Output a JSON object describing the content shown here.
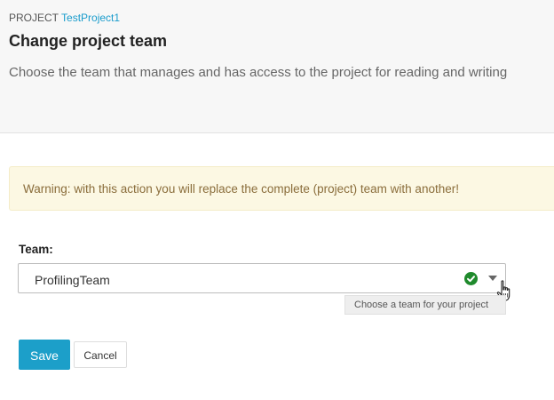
{
  "header": {
    "breadcrumb_prefix": "PROJECT",
    "project_name": "TestProject1",
    "title": "Change project team",
    "description": "Choose the team that manages and has access to the project for reading and writing"
  },
  "warning": {
    "text": "Warning: with this action you will replace the complete (project) team with another!"
  },
  "form": {
    "team_label": "Team:",
    "team_value": "ProfilingTeam",
    "team_tooltip": "Choose a team for your project",
    "status_icon": "check-circle-icon",
    "dropdown_icon": "caret-down-icon"
  },
  "actions": {
    "save_label": "Save",
    "cancel_label": "Cancel"
  },
  "colors": {
    "accent": "#1c9fc9",
    "success": "#1f8a2c",
    "warning_bg": "#fcf8e3",
    "warning_text": "#8a6d3b"
  }
}
